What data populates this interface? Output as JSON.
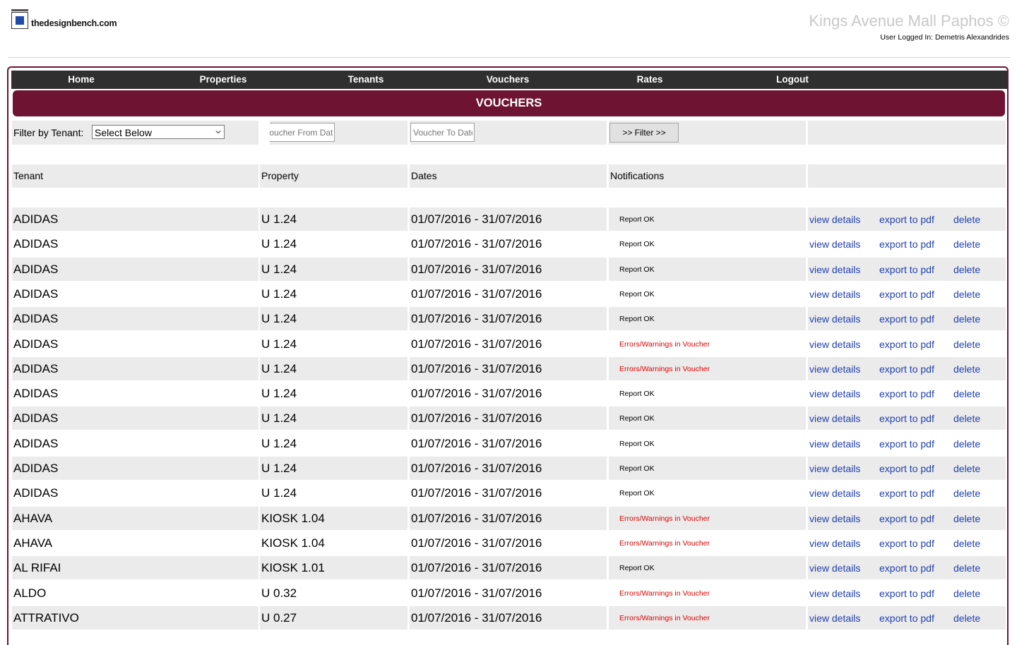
{
  "logo": {
    "text_bold": "thedesignbench",
    "text_tail": ".com"
  },
  "site_title": "Kings Avenue Mall Paphos ©",
  "user_line": "User Logged In: Demetris Alexandrides",
  "nav": [
    {
      "label": "Home"
    },
    {
      "label": "Properties"
    },
    {
      "label": "Tenants"
    },
    {
      "label": "Vouchers"
    },
    {
      "label": "Rates"
    },
    {
      "label": "Logout"
    }
  ],
  "banner": "VOUCHERS",
  "filter": {
    "label": "Filter by Tenant:",
    "tenant_select": "Select Below",
    "from_placeholder": "Voucher From Date",
    "to_placeholder": "Voucher To Date",
    "button": ">> Filter >>"
  },
  "table": {
    "headers": [
      "Tenant",
      "Property",
      "Dates",
      "Notifications",
      ""
    ],
    "actions": {
      "view": "view details",
      "pdf": "export to pdf",
      "delete": "delete"
    },
    "rows": [
      {
        "tenant": "ADIDAS",
        "property": "U 1.24",
        "dates": "01/07/2016 - 31/07/2016",
        "notification": "Report OK",
        "status": "ok"
      },
      {
        "tenant": "ADIDAS",
        "property": "U 1.24",
        "dates": "01/07/2016 - 31/07/2016",
        "notification": "Report OK",
        "status": "ok"
      },
      {
        "tenant": "ADIDAS",
        "property": "U 1.24",
        "dates": "01/07/2016 - 31/07/2016",
        "notification": "Report OK",
        "status": "ok"
      },
      {
        "tenant": "ADIDAS",
        "property": "U 1.24",
        "dates": "01/07/2016 - 31/07/2016",
        "notification": "Report OK",
        "status": "ok"
      },
      {
        "tenant": "ADIDAS",
        "property": "U 1.24",
        "dates": "01/07/2016 - 31/07/2016",
        "notification": "Report OK",
        "status": "ok"
      },
      {
        "tenant": "ADIDAS",
        "property": "U 1.24",
        "dates": "01/07/2016 - 31/07/2016",
        "notification": "Errors/Warnings in Voucher",
        "status": "error"
      },
      {
        "tenant": "ADIDAS",
        "property": "U 1.24",
        "dates": "01/07/2016 - 31/07/2016",
        "notification": "Errors/Warnings in Voucher",
        "status": "error"
      },
      {
        "tenant": "ADIDAS",
        "property": "U 1.24",
        "dates": "01/07/2016 - 31/07/2016",
        "notification": "Report OK",
        "status": "ok"
      },
      {
        "tenant": "ADIDAS",
        "property": "U 1.24",
        "dates": "01/07/2016 - 31/07/2016",
        "notification": "Report OK",
        "status": "ok"
      },
      {
        "tenant": "ADIDAS",
        "property": "U 1.24",
        "dates": "01/07/2016 - 31/07/2016",
        "notification": "Report OK",
        "status": "ok"
      },
      {
        "tenant": "ADIDAS",
        "property": "U 1.24",
        "dates": "01/07/2016 - 31/07/2016",
        "notification": "Report OK",
        "status": "ok"
      },
      {
        "tenant": "ADIDAS",
        "property": "U 1.24",
        "dates": "01/07/2016 - 31/07/2016",
        "notification": "Report OK",
        "status": "ok"
      },
      {
        "tenant": "AHAVA",
        "property": "KIOSK 1.04",
        "dates": "01/07/2016 - 31/07/2016",
        "notification": "Errors/Warnings in Voucher",
        "status": "error"
      },
      {
        "tenant": "AHAVA",
        "property": "KIOSK 1.04",
        "dates": "01/07/2016 - 31/07/2016",
        "notification": "Errors/Warnings in Voucher",
        "status": "error"
      },
      {
        "tenant": "AL RIFAI",
        "property": "KIOSK 1.01",
        "dates": "01/07/2016 - 31/07/2016",
        "notification": "Report OK",
        "status": "ok"
      },
      {
        "tenant": "ALDO",
        "property": "U 0.32",
        "dates": "01/07/2016 - 31/07/2016",
        "notification": "Errors/Warnings in Voucher",
        "status": "error"
      },
      {
        "tenant": "ATTRATIVO",
        "property": "U 0.27",
        "dates": "01/07/2016 - 31/07/2016",
        "notification": "Errors/Warnings in Voucher",
        "status": "error"
      }
    ]
  },
  "colors": {
    "brand": "#6e1432",
    "nav_bg": "#2f2f2f",
    "link": "#1f3fae",
    "error": "#e00000"
  }
}
